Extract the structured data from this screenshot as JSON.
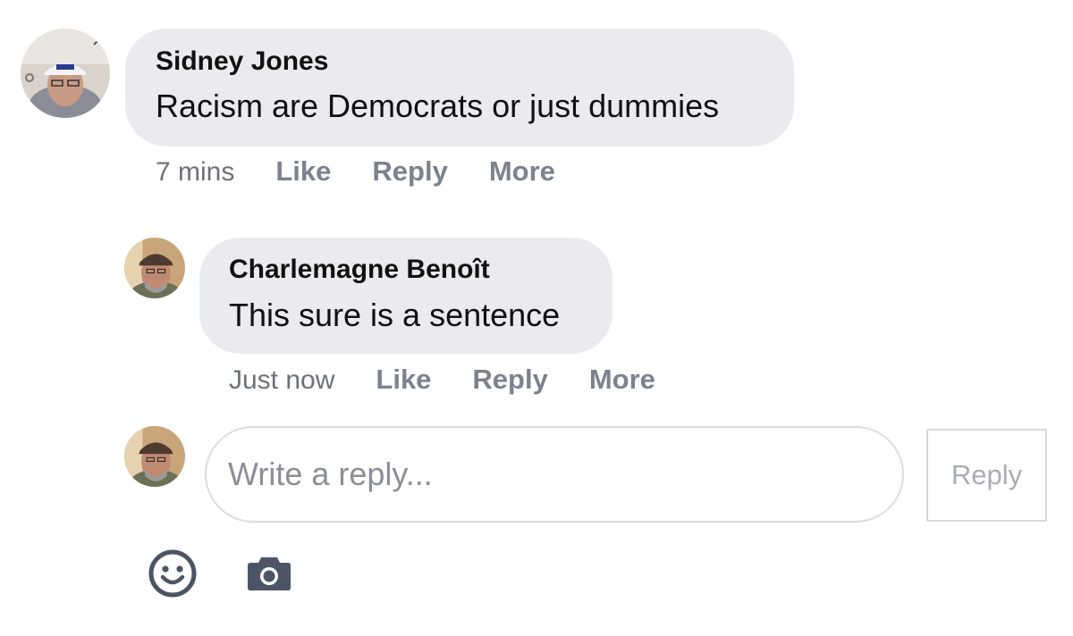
{
  "comments": [
    {
      "author": "Sidney Jones",
      "text": "Racism are Democrats or just dummies",
      "time": "7 mins",
      "actions": {
        "like": "Like",
        "reply": "Reply",
        "more": "More"
      }
    },
    {
      "author": "Charlemagne Benoît",
      "text": "This sure is a sentence",
      "time": "Just now",
      "actions": {
        "like": "Like",
        "reply": "Reply",
        "more": "More"
      }
    }
  ],
  "composer": {
    "placeholder": "Write a reply...",
    "submit_label": "Reply",
    "icons": [
      "smiley-icon",
      "camera-icon"
    ]
  },
  "colors": {
    "bubble": "#eaebef",
    "action_text": "#7c828d",
    "icon": "#4b5565"
  }
}
